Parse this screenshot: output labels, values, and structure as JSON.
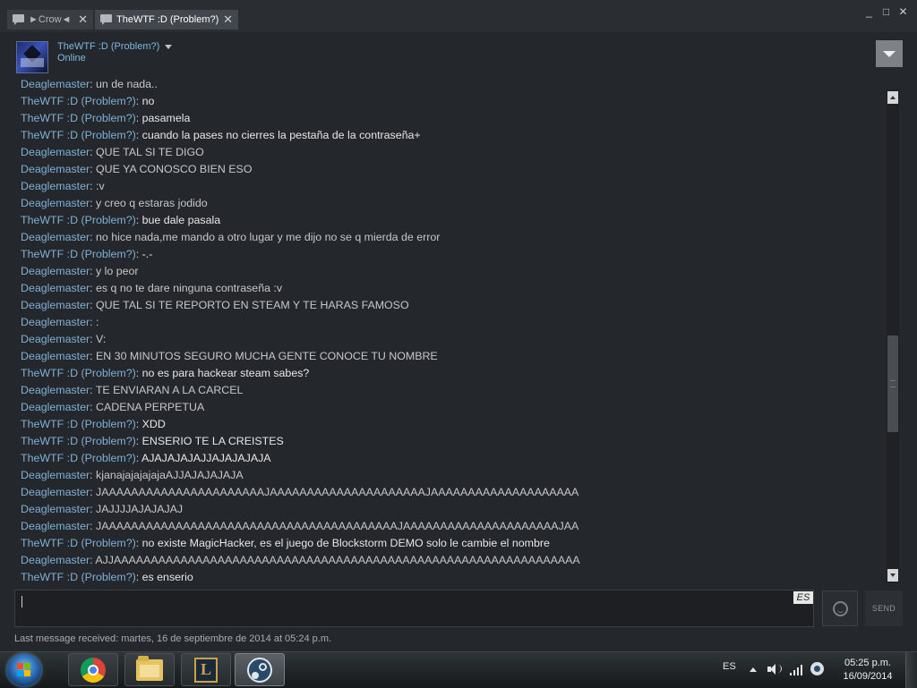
{
  "window": {
    "tabs": [
      {
        "label": "►Crow◄"
      },
      {
        "label": "TheWTF :D (Problem?)"
      }
    ],
    "minimize": "_",
    "maximize": "□",
    "close": "✕"
  },
  "header": {
    "name": "TheWTF :D (Problem?)",
    "status": "Online"
  },
  "messages": [
    {
      "sender": "Deaglemaster",
      "text": "un de nada..",
      "self": false
    },
    {
      "sender": "TheWTF :D (Problem?)",
      "text": "no",
      "self": true
    },
    {
      "sender": "TheWTF :D (Problem?)",
      "text": "pasamela",
      "self": true
    },
    {
      "sender": "TheWTF :D (Problem?)",
      "text": "cuando la pases no cierres la pestaña de la contraseña+",
      "self": true
    },
    {
      "sender": "Deaglemaster",
      "text": "QUE TAL SI TE DIGO",
      "self": false
    },
    {
      "sender": "Deaglemaster",
      "text": "QUE YA CONOSCO BIEN ESO",
      "self": false
    },
    {
      "sender": "Deaglemaster",
      "text": ":v",
      "self": false
    },
    {
      "sender": "Deaglemaster",
      "text": "y creo q estaras jodido",
      "self": false
    },
    {
      "sender": "TheWTF :D (Problem?)",
      "text": "bue dale pasala",
      "self": true
    },
    {
      "sender": "Deaglemaster",
      "text": "no hice nada,me mando a otro lugar y me dijo no se q mierda de error",
      "self": false
    },
    {
      "sender": "TheWTF :D (Problem?)",
      "text": "-.-",
      "self": true
    },
    {
      "sender": "Deaglemaster",
      "text": "y lo peor",
      "self": false
    },
    {
      "sender": "Deaglemaster",
      "text": "es q no te dare ninguna contraseña :v",
      "self": false
    },
    {
      "sender": "Deaglemaster",
      "text": "QUE TAL SI TE REPORTO EN STEAM Y TE HARAS FAMOSO",
      "self": false
    },
    {
      "sender": "Deaglemaster",
      "text": ":",
      "self": false
    },
    {
      "sender": "Deaglemaster",
      "text": "V:",
      "self": false
    },
    {
      "sender": "Deaglemaster",
      "text": "EN 30 MINUTOS SEGURO MUCHA GENTE CONOCE TU NOMBRE",
      "self": false
    },
    {
      "sender": "TheWTF :D (Problem?)",
      "text": "no es para hackear steam sabes?",
      "self": true
    },
    {
      "sender": "Deaglemaster",
      "text": "TE ENVIARAN A LA CARCEL",
      "self": false
    },
    {
      "sender": "Deaglemaster",
      "text": "CADENA PERPETUA",
      "self": false
    },
    {
      "sender": "TheWTF :D (Problem?)",
      "text": "XDD",
      "self": true
    },
    {
      "sender": "TheWTF :D (Problem?)",
      "text": "ENSERIO TE LA CREISTES",
      "self": true
    },
    {
      "sender": "TheWTF :D (Problem?)",
      "text": "AJAJAJAJAJJAJAJAJAJA",
      "self": true
    },
    {
      "sender": "Deaglemaster",
      "text": "kjanajajajajajaAJJAJAJAJAJA",
      "self": false
    },
    {
      "sender": "Deaglemaster",
      "text": "JAAAAAAAAAAAAAAAAAAAAAAJAAAAAAAAAAAAAAAAAAAAAJAAAAAAAAAAAAAAAAAAAA",
      "self": false
    },
    {
      "sender": "Deaglemaster",
      "text": "JAJJJJAJAJAJAJ",
      "self": false
    },
    {
      "sender": "Deaglemaster",
      "text": "JAAAAAAAAAAAAAAAAAAAAAAAAAAAAAAAAAAAAAAAAJAAAAAAAAAAAAAAAAAAAAAJAA",
      "self": false
    },
    {
      "sender": "TheWTF :D (Problem?)",
      "text": "no existe MagicHacker, es el juego de Blockstorm DEMO solo le cambie el nombre",
      "self": true
    },
    {
      "sender": "Deaglemaster",
      "text": "AJJAAAAAAAAAAAAAAAAAAAAAAAAAAAAAAAAAAAAAAAAAAAAAAAAAAAAAAAAAAAAAAA",
      "self": false
    },
    {
      "sender": "TheWTF :D (Problem?)",
      "text": "es enserio",
      "self": true
    }
  ],
  "input": {
    "language": "ES",
    "send_label": "SEND"
  },
  "footer": {
    "last_message": "Last message received: martes, 16 de septiembre de 2014 at 05:24 p.m."
  },
  "taskbar": {
    "language": "ES",
    "time": "05:25 p.m.",
    "date": "16/09/2014",
    "apps": [
      {
        "icon": "chrome-icon"
      },
      {
        "icon": "folder-icon"
      },
      {
        "icon": "league-of-legends-icon",
        "glyph": "L"
      },
      {
        "icon": "steam-icon"
      }
    ]
  }
}
